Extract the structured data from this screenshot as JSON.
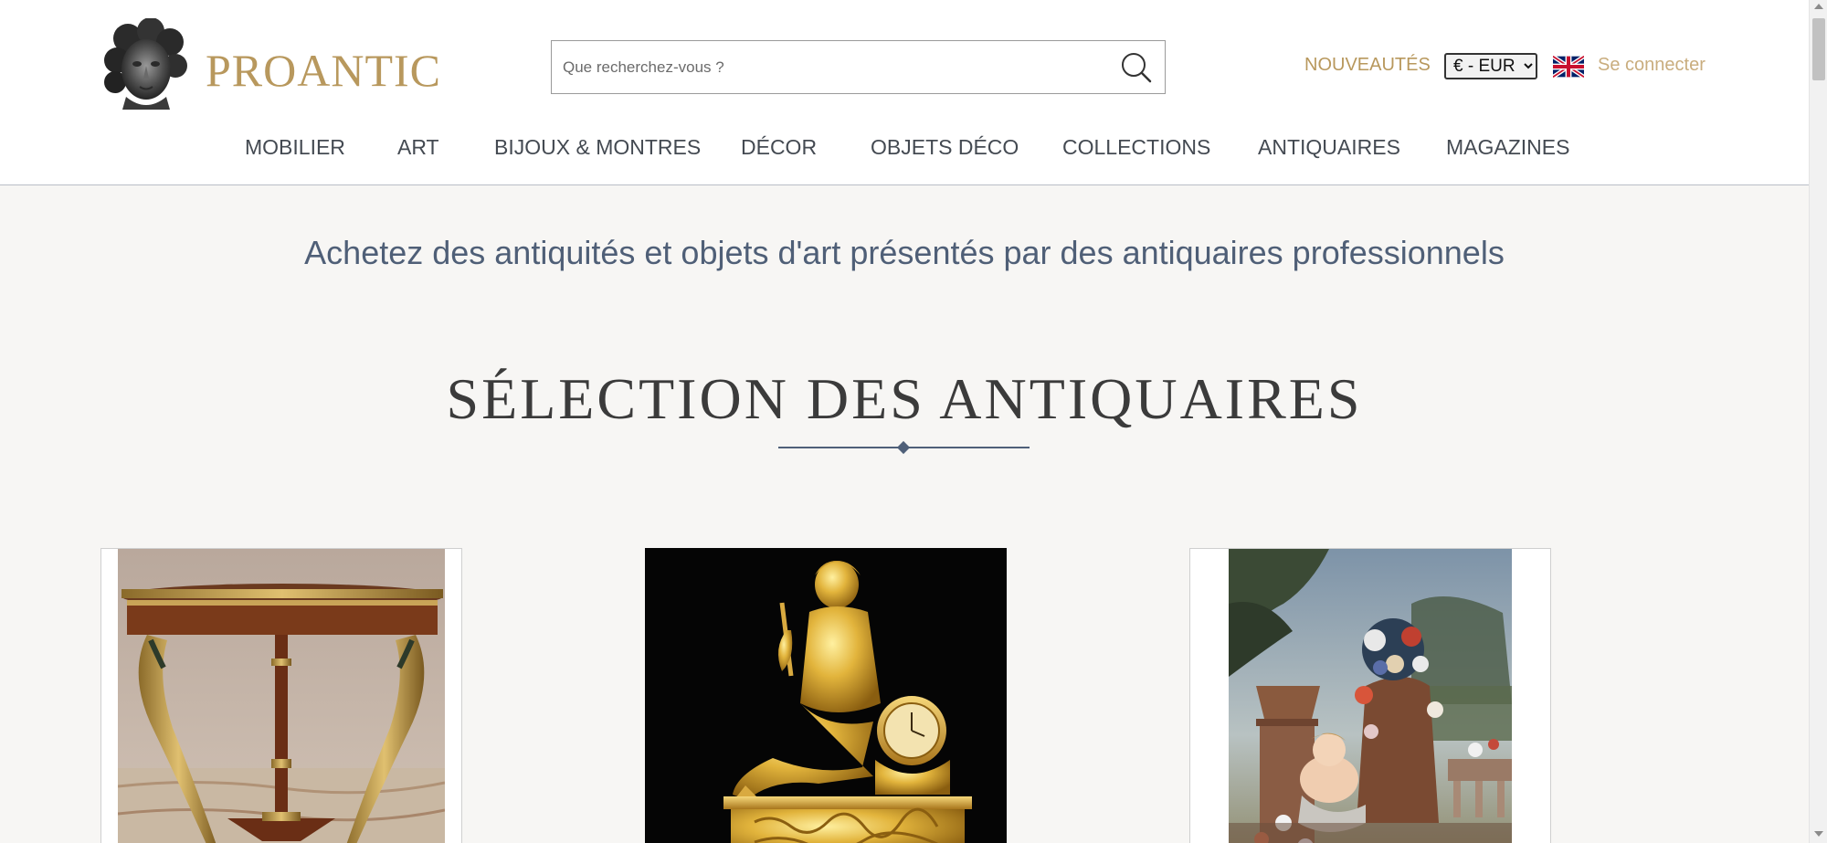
{
  "header": {
    "logo_text": "PROANTIC",
    "search_placeholder": "Que recherchez-vous ?",
    "nouveautes_label": "NOUVEAUTÉS",
    "currency_selected": "€ - EUR",
    "login_label": "Se connecter"
  },
  "nav": {
    "items": [
      {
        "label": "MOBILIER"
      },
      {
        "label": "ART"
      },
      {
        "label": "BIJOUX & MONTRES"
      },
      {
        "label": "DÉCOR"
      },
      {
        "label": "OBJETS DÉCO"
      },
      {
        "label": "COLLECTIONS"
      },
      {
        "label": "ANTIQUAIRES"
      },
      {
        "label": "MAGAZINES"
      }
    ]
  },
  "main": {
    "tagline": "Achetez des antiquités et objets d'art présentés par des antiquaires professionnels",
    "section_title": "SÉLECTION DES ANTIQUAIRES"
  },
  "cards": [
    {
      "subject": "gueridon-table"
    },
    {
      "subject": "gilt-bronze-clock"
    },
    {
      "subject": "floral-painting"
    }
  ],
  "icons": {
    "search": "search-icon",
    "flag": "uk-flag-icon",
    "logo": "bust-logo-icon"
  },
  "colors": {
    "brand_gold": "#b8985d",
    "nav_text": "#444a52",
    "tagline_blue": "#4f5f77",
    "page_bg": "#f7f6f4"
  }
}
